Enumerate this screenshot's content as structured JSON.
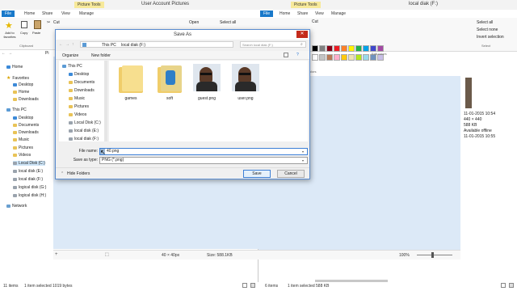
{
  "left_window": {
    "title": "User Account Pictures",
    "context_tab": "Picture Tools",
    "tabs": [
      "File",
      "Home",
      "Share",
      "View",
      "Manage"
    ],
    "ribbon": {
      "add_favorites": "Add to favorites",
      "copy": "Copy",
      "paste": "Paste",
      "cut": "Cut",
      "open": "Open",
      "select_all": "Select all",
      "clipboard_group": "Clipboard"
    },
    "address_fragment": "Pi",
    "nav": {
      "home": "Home",
      "favorites": "Favorites",
      "fav_items": [
        "Desktop",
        "Home",
        "Downloads"
      ],
      "this_pc": "This PC",
      "pc_items": [
        "Desktop",
        "Documents",
        "Downloads",
        "Music",
        "Pictures",
        "Videos"
      ],
      "drives": [
        "Local Disk (C:)",
        "local disk (E:)",
        "local diak (F:)",
        "logical disk (G:)",
        "logical disk (H:)"
      ],
      "network": "Network"
    },
    "status": {
      "items": "11 items",
      "selected": "1 item selected  1019 bytes",
      "dimensions": "40 × 40px",
      "size": "Size: 588.1KB",
      "zoom": "100%"
    }
  },
  "right_window": {
    "title": "local diak (F:)",
    "context_tab": "Picture Tools",
    "tabs": [
      "File",
      "Home",
      "Share",
      "View",
      "Manage"
    ],
    "ribbon": {
      "select_all": "Select all",
      "select_none": "Select none",
      "invert_selection": "Invert selection",
      "select_group": "Select",
      "cut": "Cut",
      "colors_group": "Colors",
      "edit_colors": "Edit colors"
    },
    "details": {
      "date1": "11-01-2015 10:54",
      "dims": "440 × 440",
      "size": "588 KB",
      "availability": "Available offline",
      "date2": "11-01-2015 10:55"
    },
    "status": {
      "items": "6 items",
      "selected": "1 item selected  588 KB"
    },
    "palette": [
      "#000000",
      "#7f7f7f",
      "#880015",
      "#ed1c24",
      "#ff7f27",
      "#fff200",
      "#22b14c",
      "#00a2e8",
      "#3f48cc",
      "#a349a4",
      "#ffffff",
      "#c3c3c3",
      "#b97a57",
      "#ffaec9",
      "#ffc90e",
      "#efe4b0",
      "#b5e61d",
      "#99d9ea",
      "#7092be",
      "#c8bfe7"
    ]
  },
  "dialog": {
    "title": "Save As",
    "breadcrumb": [
      "This PC",
      "local diak (F:)"
    ],
    "search_placeholder": "Search local diak (F:)",
    "organize": "Organize",
    "new_folder": "New folder",
    "tree": [
      "This PC",
      "Desktop",
      "Documents",
      "Downloads",
      "Music",
      "Pictures",
      "Videos",
      "Local Disk (C:)",
      "local disk (E:)",
      "local diak (F:)"
    ],
    "files": [
      "games",
      "soft",
      "guest.png",
      "user.png"
    ],
    "file_name_label": "File name:",
    "file_name_value": "40.png",
    "save_type_label": "Save as type:",
    "save_type_value": "PNG (*.png)",
    "hide_folders": "Hide Folders",
    "save": "Save",
    "cancel": "Cancel"
  }
}
